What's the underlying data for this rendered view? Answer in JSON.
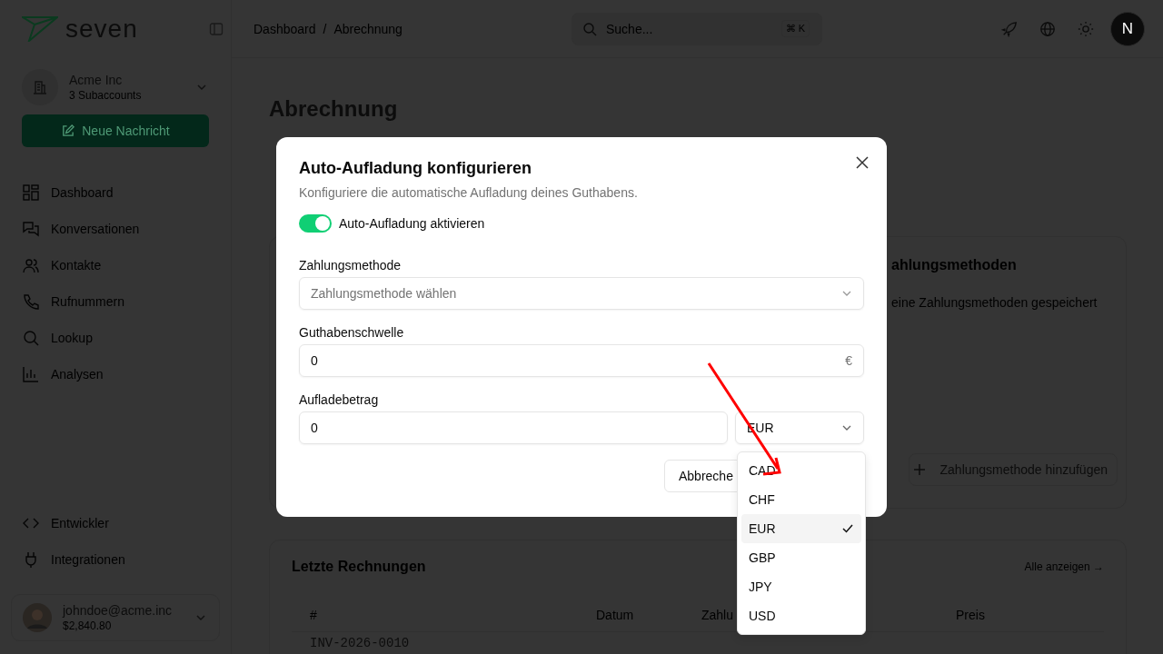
{
  "sidebar": {
    "logo": "seven",
    "account": {
      "name": "Acme Inc",
      "subtitle": "3 Subaccounts"
    },
    "new_message_button": "Neue Nachricht",
    "nav_items": [
      {
        "label": "Dashboard"
      },
      {
        "label": "Konversationen"
      },
      {
        "label": "Kontakte"
      },
      {
        "label": "Rufnummern"
      },
      {
        "label": "Lookup"
      },
      {
        "label": "Analysen"
      }
    ],
    "bottom_items": [
      {
        "label": "Entwickler"
      },
      {
        "label": "Integrationen"
      }
    ],
    "user": {
      "email": "johndoe@acme.inc",
      "balance": "$2,840.80"
    }
  },
  "header": {
    "breadcrumb": [
      "Dashboard",
      "/",
      "Abrechnung"
    ],
    "search": {
      "placeholder": "Suche...",
      "shortcut": "⌘ K"
    },
    "avatar_letter": "N"
  },
  "page": {
    "title": "Abrechnung",
    "payment_card": {
      "title": "ahlungsmethoden",
      "empty_text": "eine Zahlungsmethoden gespeichert",
      "add_button": "Zahlungsmethode hinzufügen"
    },
    "invoices": {
      "title": "Letzte Rechnungen",
      "view_all": "Alle anzeigen →",
      "columns": [
        "#",
        "Datum",
        "Zahlu",
        "Preis"
      ],
      "rows": [
        [
          "INV-2026-0010"
        ]
      ]
    }
  },
  "dialog": {
    "title": "Auto-Aufladung konfigurieren",
    "description": "Konfiguriere die automatische Aufladung deines Guthabens.",
    "toggle": {
      "label": "Auto-Aufladung aktivieren",
      "on": true
    },
    "fields": [
      {
        "kind": "select",
        "label": "Zahlungsmethode",
        "placeholder": "Zahlungsmethode wählen"
      },
      {
        "kind": "input",
        "label": "Guthabenschwelle",
        "value": "0",
        "suffix": "€"
      },
      {
        "kind": "amount",
        "label": "Aufladebetrag",
        "value": "0",
        "currency": "EUR"
      }
    ],
    "cancel_button": "Abbreche",
    "currency_menu": [
      {
        "label": "CAD",
        "selected": false
      },
      {
        "label": "CHF",
        "selected": false
      },
      {
        "label": "EUR",
        "selected": true
      },
      {
        "label": "GBP",
        "selected": false
      },
      {
        "label": "JPY",
        "selected": false
      },
      {
        "label": "USD",
        "selected": false
      }
    ]
  }
}
